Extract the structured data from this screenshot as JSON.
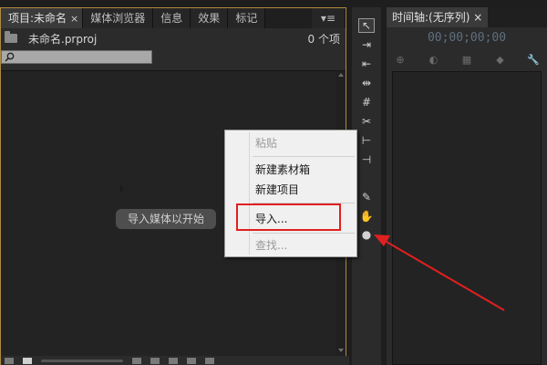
{
  "project_panel": {
    "tabs": [
      {
        "label": "项目:未命名",
        "close": "×"
      },
      {
        "label": "媒体浏览器"
      },
      {
        "label": "信息"
      },
      {
        "label": "效果"
      },
      {
        "label": "标记"
      }
    ],
    "tab_menu": "▾≡",
    "project_file": "未命名.prproj",
    "item_count": "0 个项",
    "search_placeholder": "",
    "import_hint": "导入媒体以开始"
  },
  "tools": [
    {
      "name": "selection-tool-icon",
      "glyph": "↖"
    },
    {
      "name": "track-select-tool-icon",
      "glyph": "⇥"
    },
    {
      "name": "ripple-edit-tool-icon",
      "glyph": "⇤"
    },
    {
      "name": "rolling-edit-tool-icon",
      "glyph": "⇹"
    },
    {
      "name": "rate-stretch-tool-icon",
      "glyph": "#"
    },
    {
      "name": "razor-tool-icon",
      "glyph": "✂"
    },
    {
      "name": "slip-tool-icon",
      "glyph": "⊢"
    },
    {
      "name": "slide-tool-icon",
      "glyph": "⊣"
    },
    {
      "name": "pen-tool-icon",
      "glyph": "✎"
    },
    {
      "name": "hand-tool-icon",
      "glyph": "✋"
    },
    {
      "name": "zoom-tool-icon",
      "glyph": "●"
    }
  ],
  "timeline": {
    "tab_label": "时间轴:(无序列)",
    "close": "×",
    "timecode": "00;00;00;00"
  },
  "context_menu": {
    "items": [
      {
        "label": "粘贴",
        "enabled": false
      },
      {
        "label": "新建素材箱",
        "enabled": true
      },
      {
        "label": "新建项目",
        "enabled": true,
        "submenu": true
      },
      {
        "label": "导入...",
        "enabled": true,
        "highlighted": true
      },
      {
        "label": "查找...",
        "enabled": false
      }
    ]
  },
  "colors": {
    "annotation_red": "#e02020",
    "panel_border_active": "#b08a3e",
    "timecode": "#5f6f80"
  }
}
